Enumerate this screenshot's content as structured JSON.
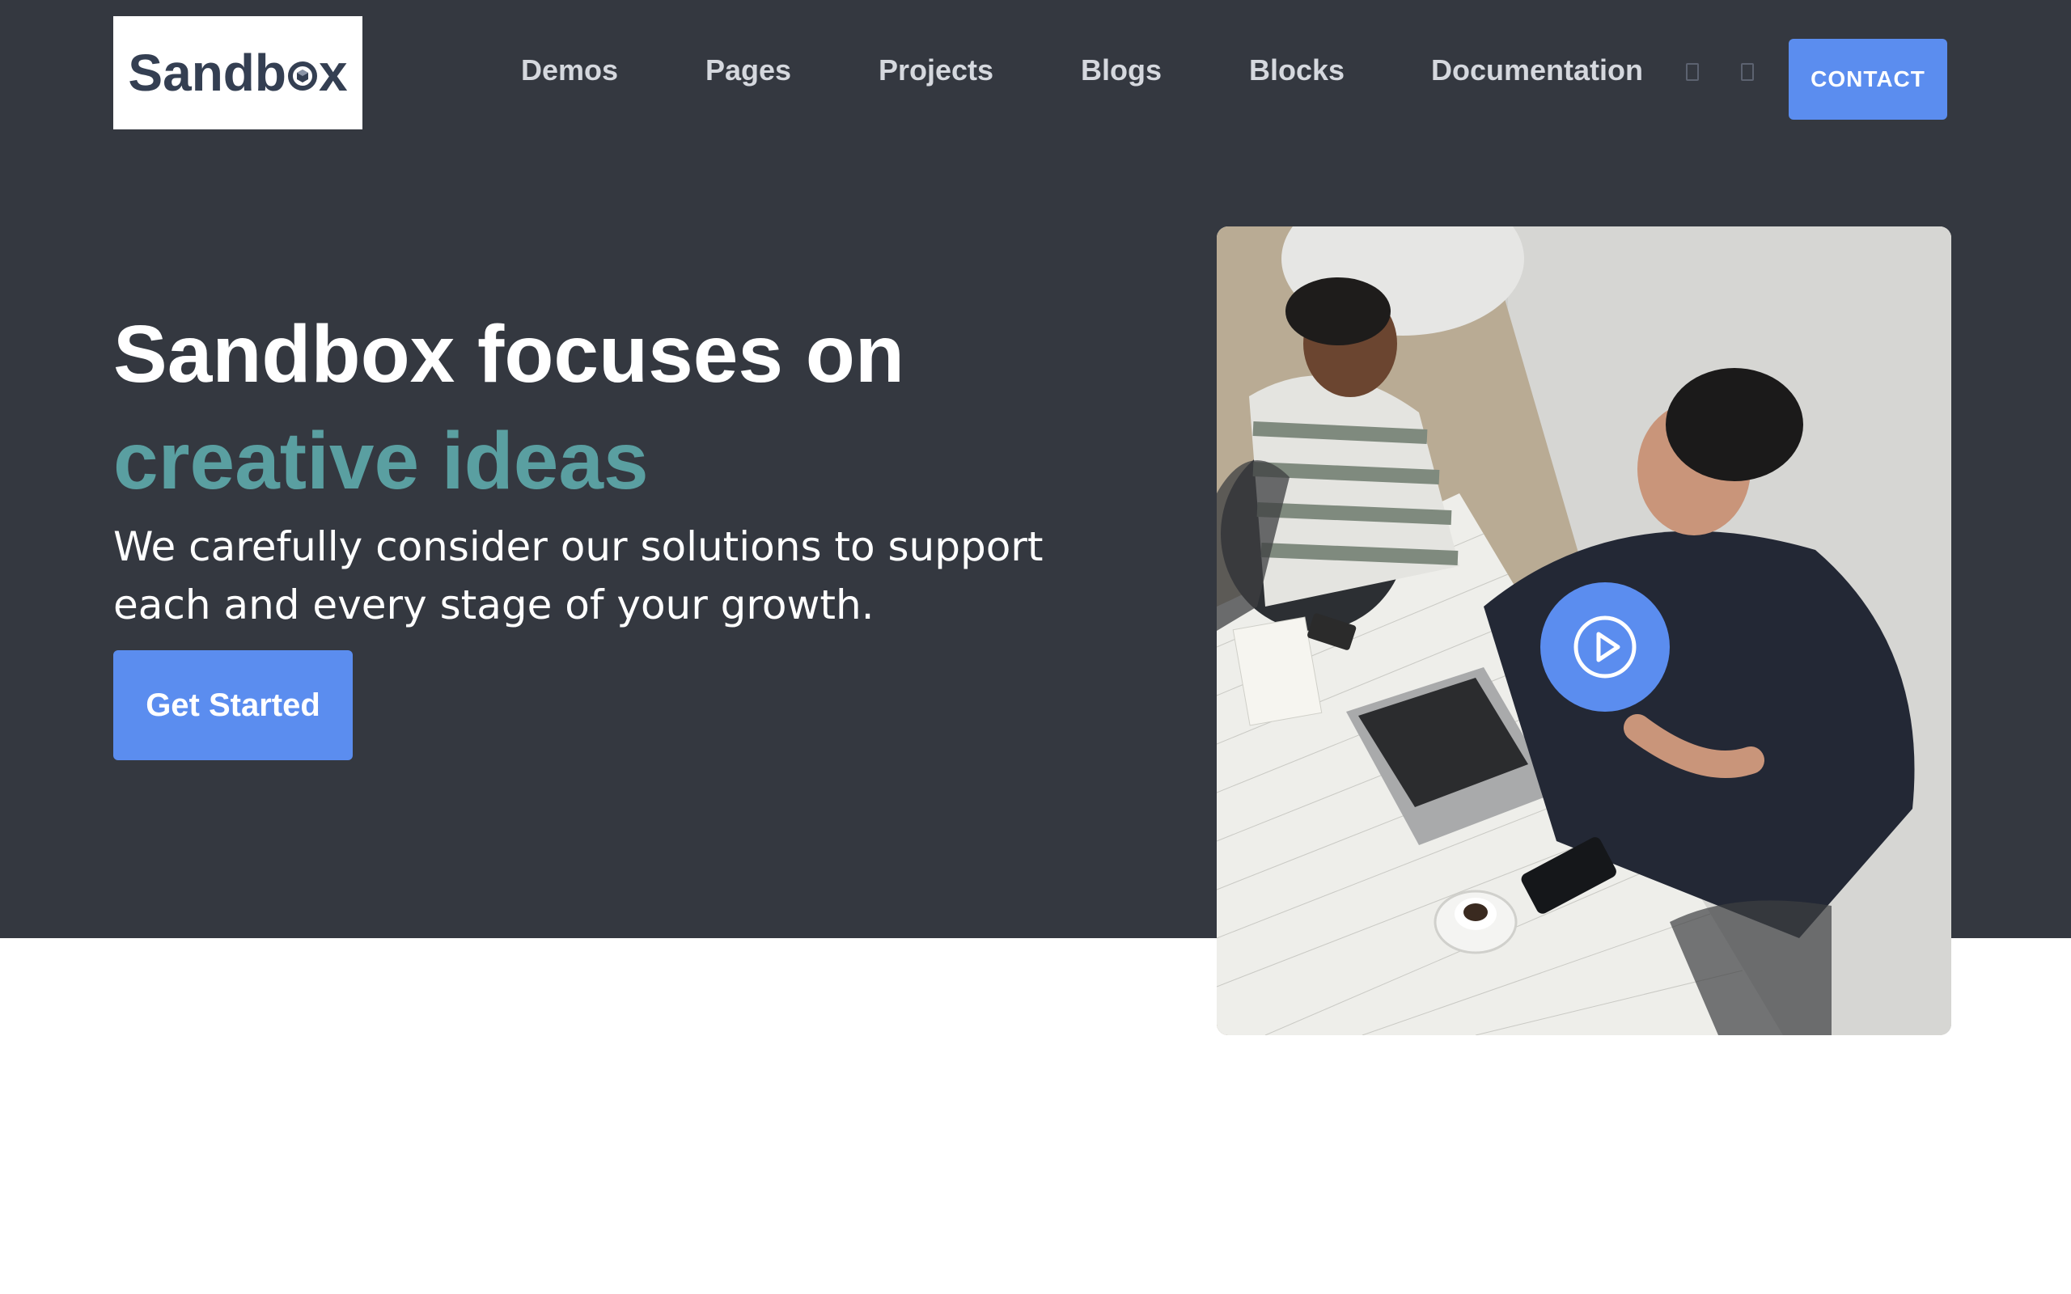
{
  "header": {
    "logo": {
      "text_before": "Sandb",
      "text_after": "x",
      "icon": "cube-icon"
    },
    "nav": [
      {
        "label": "Demos"
      },
      {
        "label": "Pages"
      },
      {
        "label": "Projects"
      },
      {
        "label": "Blogs"
      },
      {
        "label": "Blocks"
      },
      {
        "label": "Documentation"
      }
    ],
    "nav_icons": [
      "language-icon",
      "menu-icon"
    ],
    "contact_label": "CONTACT"
  },
  "hero": {
    "title": "Sandbox focuses on",
    "title_accent": "creative ideas",
    "subtitle": "We carefully consider our solutions to support each and every stage of your growth.",
    "cta_label": "Get Started",
    "play_icon": "play-icon",
    "image_icon": "meeting-photo"
  },
  "colors": {
    "hero_background": "#343840",
    "accent": "#5a9fa1",
    "primary_button": "#5b8def",
    "nav_text": "#d5d8de",
    "logo_text": "#343f52"
  }
}
